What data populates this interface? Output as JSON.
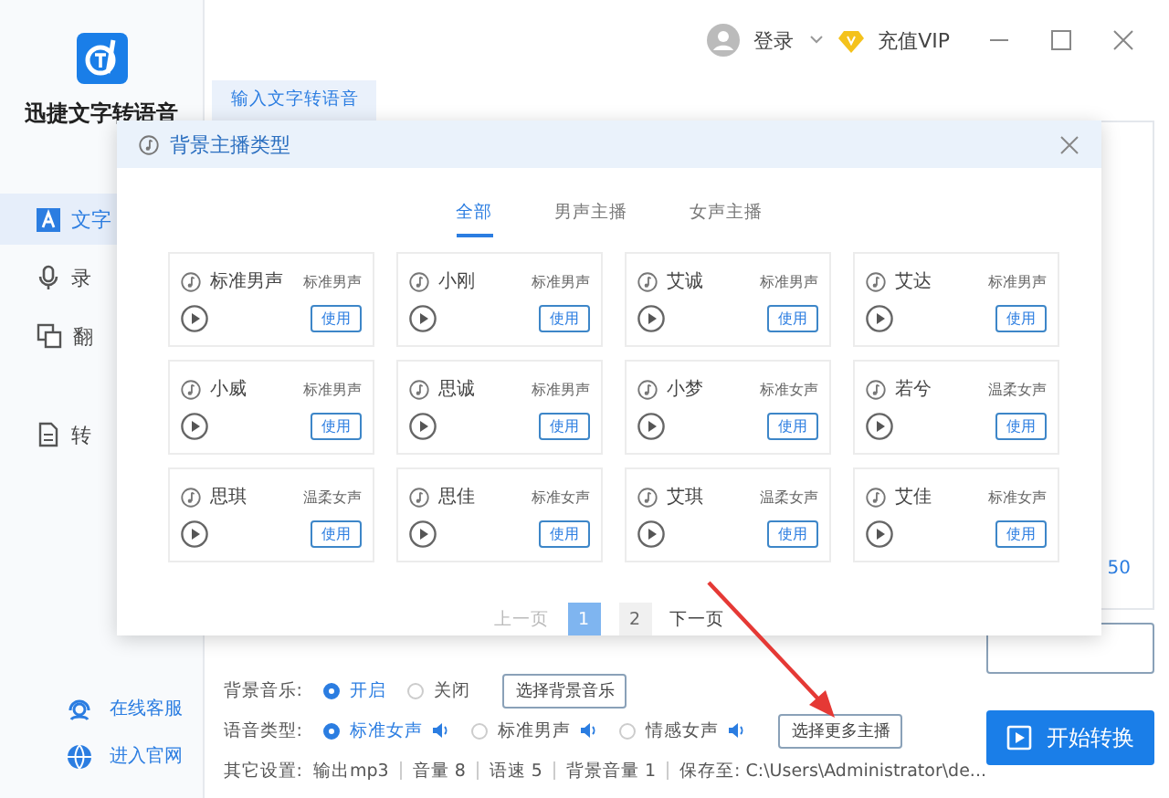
{
  "app": {
    "title": "迅捷文字转语音"
  },
  "sidebar": {
    "items": [
      {
        "kind": "text",
        "label": "文字",
        "selected": true
      },
      {
        "kind": "record",
        "label": "录",
        "selected": false
      },
      {
        "kind": "translate",
        "label": "翻",
        "selected": false
      },
      {
        "kind": "convert",
        "label": "转",
        "selected": false
      }
    ],
    "links": [
      {
        "kind": "support",
        "label": "在线客服"
      },
      {
        "kind": "web",
        "label": "进入官网"
      }
    ]
  },
  "header": {
    "login": "登录",
    "vip": "充值VIP"
  },
  "tabs": [
    {
      "label": "输入文字转语音",
      "selected": true
    }
  ],
  "editor": {
    "counter": "50"
  },
  "dialog": {
    "title": "背景主播类型",
    "tabs": [
      {
        "label": "全部",
        "selected": true
      },
      {
        "label": "男声主播",
        "selected": false
      },
      {
        "label": "女声主播",
        "selected": false
      }
    ],
    "voices": [
      {
        "name": "标准男声",
        "type": "标准男声",
        "button": "使用"
      },
      {
        "name": "小刚",
        "type": "标准男声",
        "button": "使用"
      },
      {
        "name": "艾诚",
        "type": "标准男声",
        "button": "使用"
      },
      {
        "name": "艾达",
        "type": "标准男声",
        "button": "使用"
      },
      {
        "name": "小威",
        "type": "标准男声",
        "button": "使用"
      },
      {
        "name": "思诚",
        "type": "标准男声",
        "button": "使用"
      },
      {
        "name": "小梦",
        "type": "标准女声",
        "button": "使用"
      },
      {
        "name": "若兮",
        "type": "温柔女声",
        "button": "使用"
      },
      {
        "name": "思琪",
        "type": "温柔女声",
        "button": "使用"
      },
      {
        "name": "思佳",
        "type": "标准女声",
        "button": "使用"
      },
      {
        "name": "艾琪",
        "type": "温柔女声",
        "button": "使用"
      },
      {
        "name": "艾佳",
        "type": "标准女声",
        "button": "使用"
      }
    ],
    "pagination": {
      "prev": "上一页",
      "next": "下一页",
      "pages": [
        {
          "label": "1",
          "selected": true
        },
        {
          "label": "2",
          "selected": false
        }
      ]
    }
  },
  "settings": {
    "rows": [
      {
        "label": "背景音乐:",
        "options": [
          {
            "label": "开启",
            "selected": true,
            "speaker": false
          },
          {
            "label": "关闭",
            "selected": false,
            "speaker": false
          }
        ],
        "button": "选择背景音乐"
      },
      {
        "label": "语音类型:",
        "options": [
          {
            "label": "标准女声",
            "selected": true,
            "speaker": true
          },
          {
            "label": "标准男声",
            "selected": false,
            "speaker": true
          },
          {
            "label": "情感女声",
            "selected": false,
            "speaker": true
          }
        ],
        "button": "选择更多主播"
      }
    ],
    "other": {
      "label": "其它设置:",
      "items": [
        "输出mp3",
        "音量 8",
        "语速 5",
        "背景音量 1",
        "保存至: C:\\Users\\Administrator\\de..."
      ]
    }
  },
  "start_button": "开始转换"
}
